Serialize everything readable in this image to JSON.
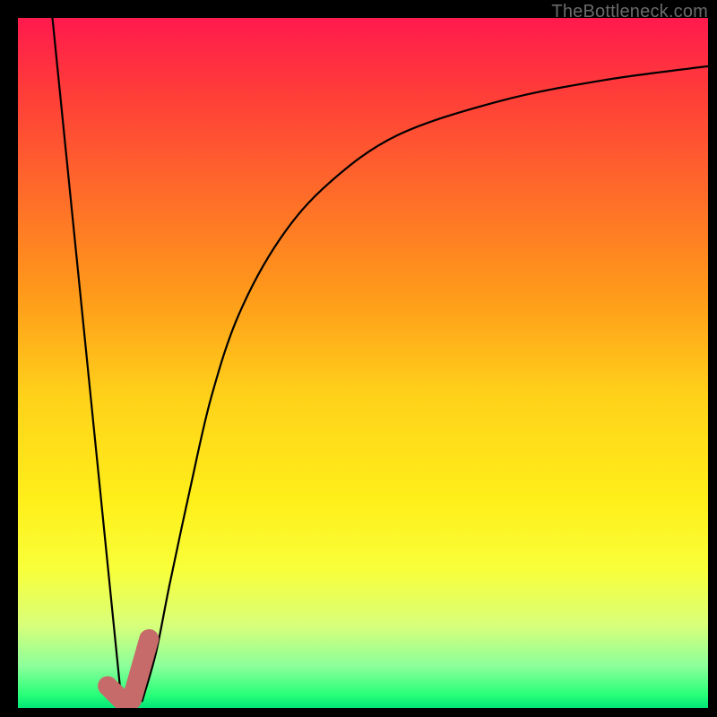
{
  "watermark": "TheBottleneck.com",
  "chart_data": {
    "type": "line",
    "title": "",
    "xlabel": "",
    "ylabel": "",
    "xlim": [
      0,
      100
    ],
    "ylim": [
      0,
      100
    ],
    "grid": false,
    "legend": false,
    "background_gradient": {
      "direction": "vertical",
      "stops": [
        {
          "pos": 0,
          "color": "#ff1a4d"
        },
        {
          "pos": 25,
          "color": "#ff6a2a"
        },
        {
          "pos": 55,
          "color": "#ffd21a"
        },
        {
          "pos": 80,
          "color": "#f8ff3a"
        },
        {
          "pos": 94,
          "color": "#8aff9a"
        },
        {
          "pos": 100,
          "color": "#00e676"
        }
      ]
    },
    "series": [
      {
        "name": "left-line",
        "color": "#000000",
        "width": 2,
        "x": [
          5,
          15
        ],
        "y": [
          100,
          1
        ]
      },
      {
        "name": "right-curve",
        "color": "#000000",
        "width": 2,
        "x": [
          18,
          20,
          22,
          25,
          28,
          32,
          38,
          45,
          55,
          70,
          85,
          100
        ],
        "y": [
          1,
          8,
          18,
          32,
          45,
          57,
          68,
          76,
          83,
          88,
          91,
          93
        ]
      },
      {
        "name": "checkmark",
        "color": "#c76a6a",
        "width": 10,
        "x": [
          13,
          15,
          16.5,
          19
        ],
        "y": [
          3.2,
          1.2,
          1.2,
          10
        ]
      }
    ]
  }
}
